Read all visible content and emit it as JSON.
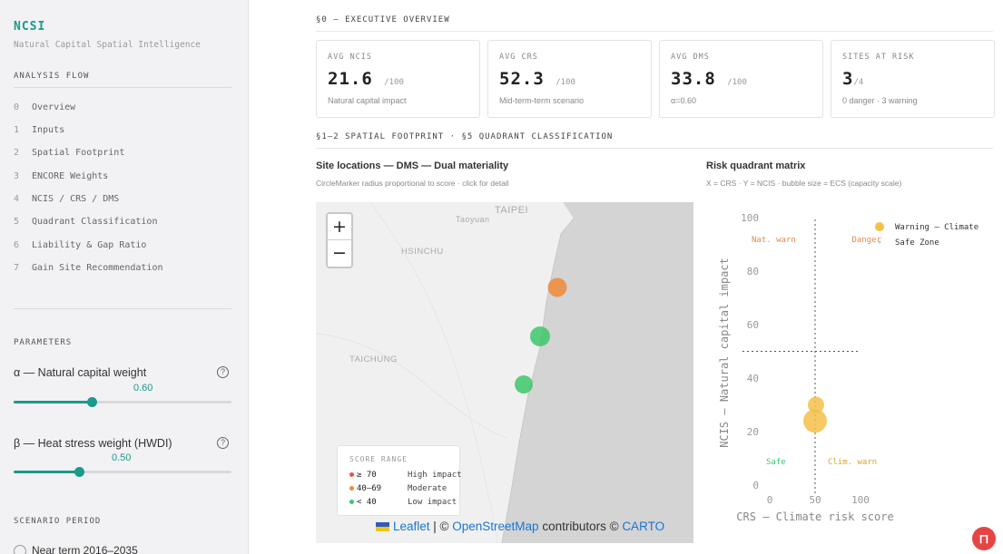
{
  "sidebar": {
    "brand": "NCSI",
    "brand_sub": "Natural Capital Spatial Intelligence",
    "flow_heading": "ANALYSIS FLOW",
    "flow_items": [
      {
        "num": "0",
        "label": "Overview"
      },
      {
        "num": "1",
        "label": "Inputs"
      },
      {
        "num": "2",
        "label": "Spatial Footprint"
      },
      {
        "num": "3",
        "label": "ENCORE Weights"
      },
      {
        "num": "4",
        "label": "NCIS / CRS / DMS"
      },
      {
        "num": "5",
        "label": "Quadrant Classification"
      },
      {
        "num": "6",
        "label": "Liability & Gap Ratio"
      },
      {
        "num": "7",
        "label": "Gain Site Recommendation"
      }
    ],
    "params_heading": "PARAMETERS",
    "params": [
      {
        "label": "α — Natural capital weight",
        "value_text": "0.60",
        "value": 0.6,
        "help_icon": "question-circle-icon"
      },
      {
        "label": "β — Heat stress weight (HWDI)",
        "value_text": "0.50",
        "value": 0.5,
        "help_icon": "question-circle-icon"
      }
    ],
    "scenario_heading": "SCENARIO PERIOD",
    "scenario_option": "Near term 2016–2035"
  },
  "overview": {
    "heading": "§0 — EXECUTIVE OVERVIEW",
    "cards": [
      {
        "label": "AVG NCIS",
        "value": "21.6",
        "unit": "/100",
        "note": "Natural capital impact"
      },
      {
        "label": "AVG CRS",
        "value": "52.3",
        "unit": "/100",
        "note": "Mid-term-term scenario"
      },
      {
        "label": "AVG DMS",
        "value": "33.8",
        "unit": "/100",
        "note": "α=0.60"
      },
      {
        "label": "SITES AT RISK",
        "value": "3",
        "unit": "/4",
        "note": "0 danger · 3 warning"
      }
    ]
  },
  "spatial": {
    "heading": "§1–2 SPATIAL FOOTPRINT · §5 QUADRANT CLASSIFICATION",
    "map_title": "Site locations — DMS — Dual materiality",
    "map_subtitle": "CircleMarker radius proportional to score · click for detail",
    "zoom_in": "+",
    "zoom_out": "−",
    "places": [
      "TAIPEI",
      "Taoyuan",
      "HSINCHU",
      "TAICHUNG"
    ],
    "legend": {
      "title": "SCORE RANGE",
      "rows": [
        {
          "range": "≥ 70",
          "desc": "High impact",
          "color": "#e8533f"
        },
        {
          "range": "40–69",
          "desc": "Moderate",
          "color": "#f08a3a"
        },
        {
          "range": "< 40",
          "desc": "Low impact",
          "color": "#3ec76a"
        }
      ]
    },
    "attribution": {
      "leaflet": "Leaflet",
      "sep": " | © ",
      "osm": "OpenStreetMap",
      "mid": " contributors © ",
      "carto": "CARTO"
    },
    "sites": [
      {
        "color": "#f08a3a",
        "category": "Moderate"
      },
      {
        "color": "#3ec76a",
        "category": "Low impact"
      },
      {
        "color": "#3ec76a",
        "category": "Low impact"
      }
    ]
  },
  "quadrant": {
    "title": "Risk quadrant matrix",
    "subtitle": "X = CRS · Y = NCIS · bubble size = ECS (capacity scale)"
  },
  "chart_data": {
    "type": "scatter",
    "xlabel": "CRS — Climate risk score",
    "ylabel": "NCIS — Natural capital impact",
    "xlim": [
      0,
      100
    ],
    "ylim": [
      0,
      100
    ],
    "xticks": [
      "0",
      "50",
      "100"
    ],
    "yticks": [
      "0",
      "20",
      "40",
      "60",
      "80",
      "100"
    ],
    "threshold_x": 50,
    "threshold_y": 50,
    "quadrant_labels": [
      {
        "text": "Nat. warn",
        "color": "#e8884a",
        "position": "top-left"
      },
      {
        "text": "Danger",
        "color": "#e8884a",
        "position": "top-right"
      },
      {
        "text": "Safe",
        "color": "#3ec76a",
        "position": "bottom-left"
      },
      {
        "text": "Clim. warn",
        "color": "#d4a72c",
        "position": "bottom-right"
      }
    ],
    "legend": [
      {
        "name": "Warning — Climate",
        "color": "#f5c04a"
      },
      {
        "name": "Safe Zone",
        "color": "#9fd8e8"
      }
    ],
    "legend_position": "top-right",
    "series": [
      {
        "name": "Warning — Climate",
        "color": "#f5c04a",
        "points": [
          {
            "x": 51,
            "y": 30,
            "size": 9
          },
          {
            "x": 50,
            "y": 24,
            "size": 13
          }
        ]
      }
    ]
  }
}
